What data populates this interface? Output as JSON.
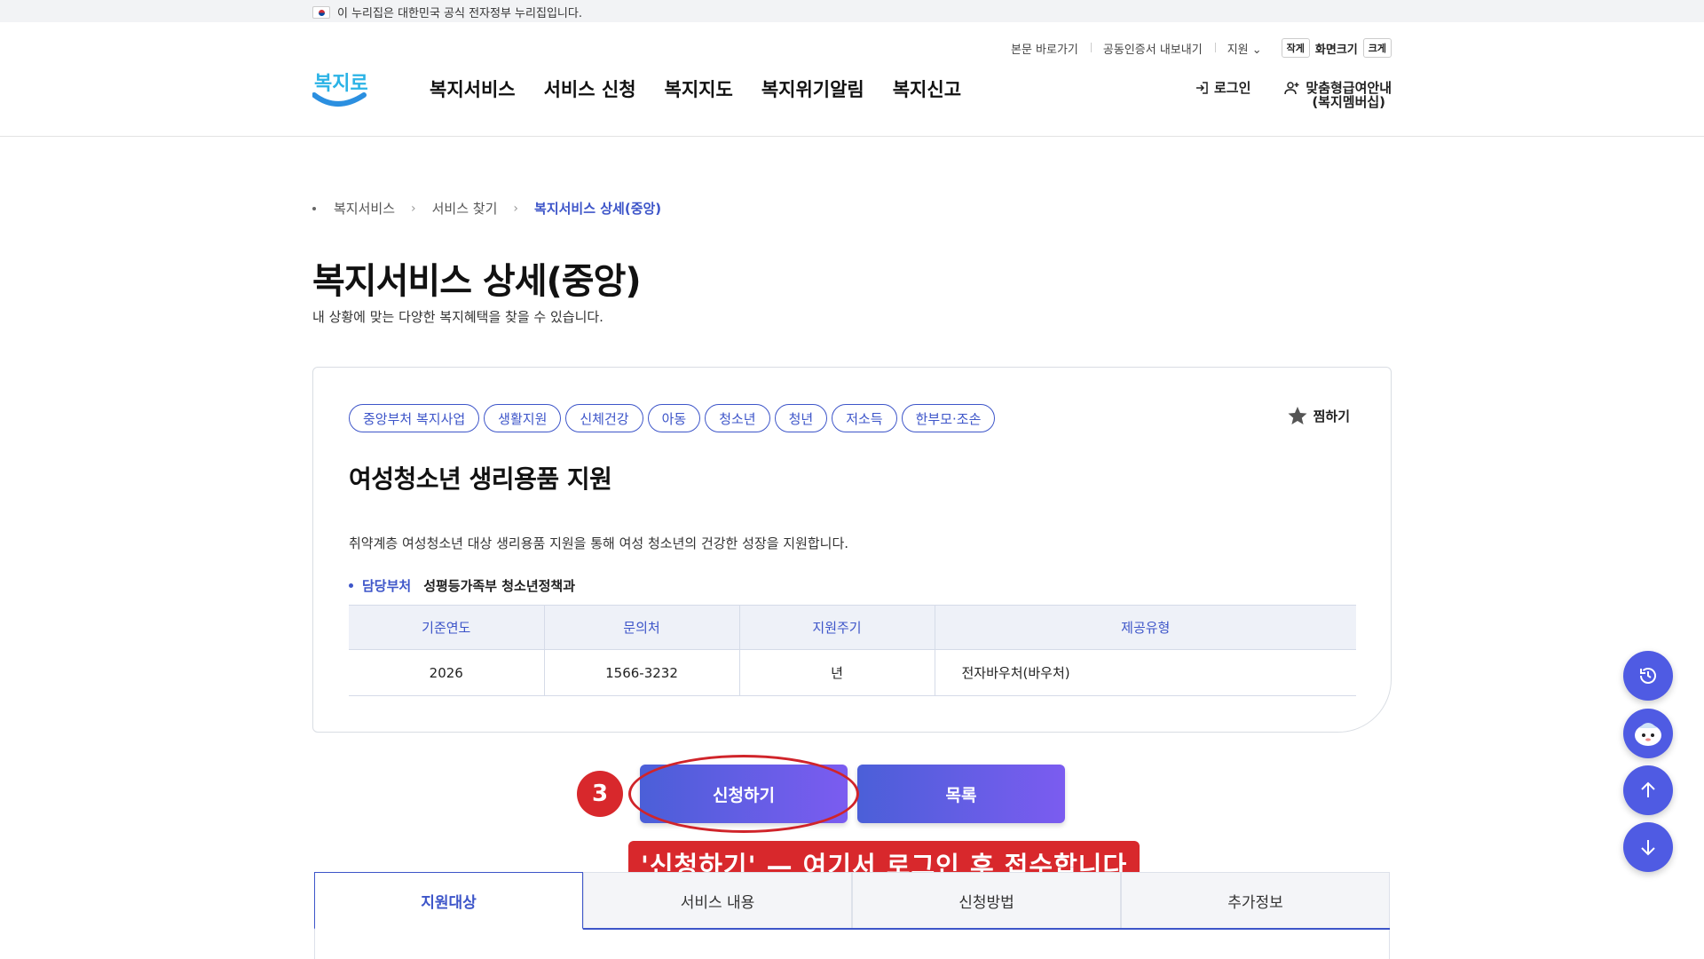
{
  "gov_banner": {
    "text": "이 누리집은 대한민국 공식 전자정부 누리집입니다."
  },
  "util": {
    "skip": "본문 바로가기",
    "cert": "공동인증서 내보내기",
    "support": "지원",
    "font_small": "작게",
    "font_label": "화면크기",
    "font_large": "크게"
  },
  "logo": {
    "text": "복지로"
  },
  "gnb": [
    "복지서비스",
    "서비스 신청",
    "복지지도",
    "복지위기알림",
    "복지신고"
  ],
  "member": {
    "login": "로그인",
    "membership_line1": "맞춤형급여안내",
    "membership_line2": "(복지멤버십)"
  },
  "breadcrumb": [
    "복지서비스",
    "서비스 찾기",
    "복지서비스 상세(중앙)"
  ],
  "page": {
    "title": "복지서비스 상세(중앙)",
    "subtitle": "내 상황에 맞는 다양한 복지혜택을 찾을 수 있습니다."
  },
  "service": {
    "tags": [
      "중앙부처 복지사업",
      "생활지원",
      "신체건강",
      "아동",
      "청소년",
      "청년",
      "저소득",
      "한부모·조손"
    ],
    "favorite": "찜하기",
    "title": "여성청소년 생리용품 지원",
    "description": "취약계층 여성청소년 대상 생리용품 지원을 통해 여성 청소년의 건강한 성장을 지원합니다.",
    "dept_label": "담당부처",
    "dept_value": "성평등가족부 청소년정책과",
    "table": {
      "headers": [
        "기준연도",
        "문의처",
        "지원주기",
        "제공유형"
      ],
      "row": [
        "2026",
        "1566-3232",
        "년",
        "전자바우처(바우처)"
      ]
    }
  },
  "buttons": {
    "apply": "신청하기",
    "list": "목록"
  },
  "annotation": {
    "step": "3",
    "callout": "'신청하기' — 여기서 로그인 후 접수합니다",
    "color": "#d8282c"
  },
  "tabs": [
    "지원대상",
    "서비스 내용",
    "신청방법",
    "추가정보"
  ],
  "colors": {
    "accent": "#3d55c9",
    "button_start": "#4b5fd8",
    "button_end": "#7b5cf0",
    "fab": "#4f5be3"
  },
  "floating": [
    "history-icon",
    "chatbot-icon",
    "arrow-up-icon",
    "arrow-down-icon"
  ]
}
